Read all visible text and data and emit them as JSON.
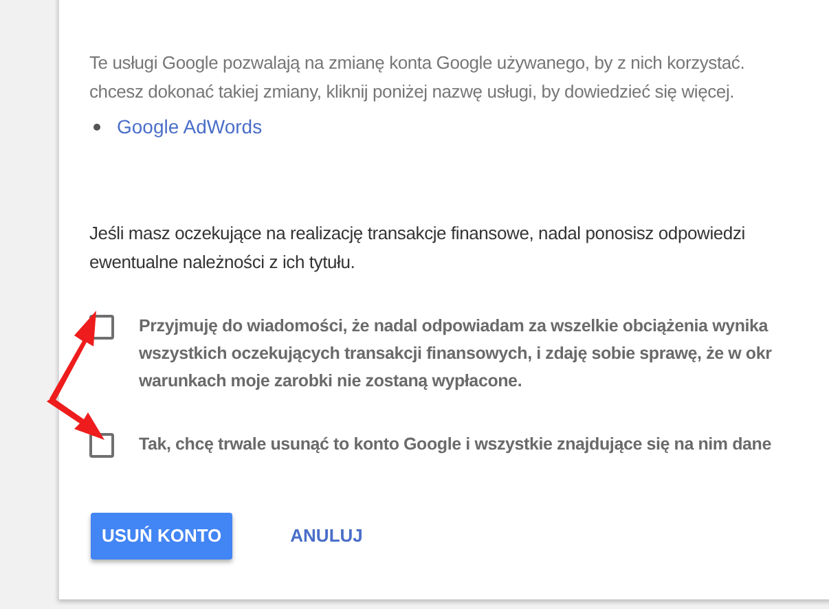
{
  "services_note": {
    "lines": [
      "Te usługi Google pozwalają na zmianę konta Google używanego, by z nich korzystać.",
      "chcesz dokonać takiej zmiany, kliknij poniżej nazwę usługi, by dowiedzieć się więcej."
    ]
  },
  "services": [
    {
      "label": "Google AdWords"
    }
  ],
  "finance_note": {
    "lines": [
      "Jeśli masz oczekujące na realizację transakcje finansowe, nadal ponosisz odpowiedzi",
      "ewentualne należności z ich tytułu."
    ]
  },
  "confirmations": [
    {
      "checked": false,
      "lines": [
        "Przyjmuję do wiadomości, że nadal odpowiadam za wszelkie obciążenia wynika",
        "wszystkich oczekujących transakcji finansowych, i zdaję sobie sprawę, że w okr",
        "warunkach moje zarobki nie zostaną wypłacone."
      ]
    },
    {
      "checked": false,
      "lines": [
        "Tak, chcę trwale usunąć to konto Google i wszystkie znajdujące się na nim dane"
      ]
    }
  ],
  "buttons": {
    "delete": "USUŃ KONTO",
    "cancel": "ANULUJ"
  }
}
